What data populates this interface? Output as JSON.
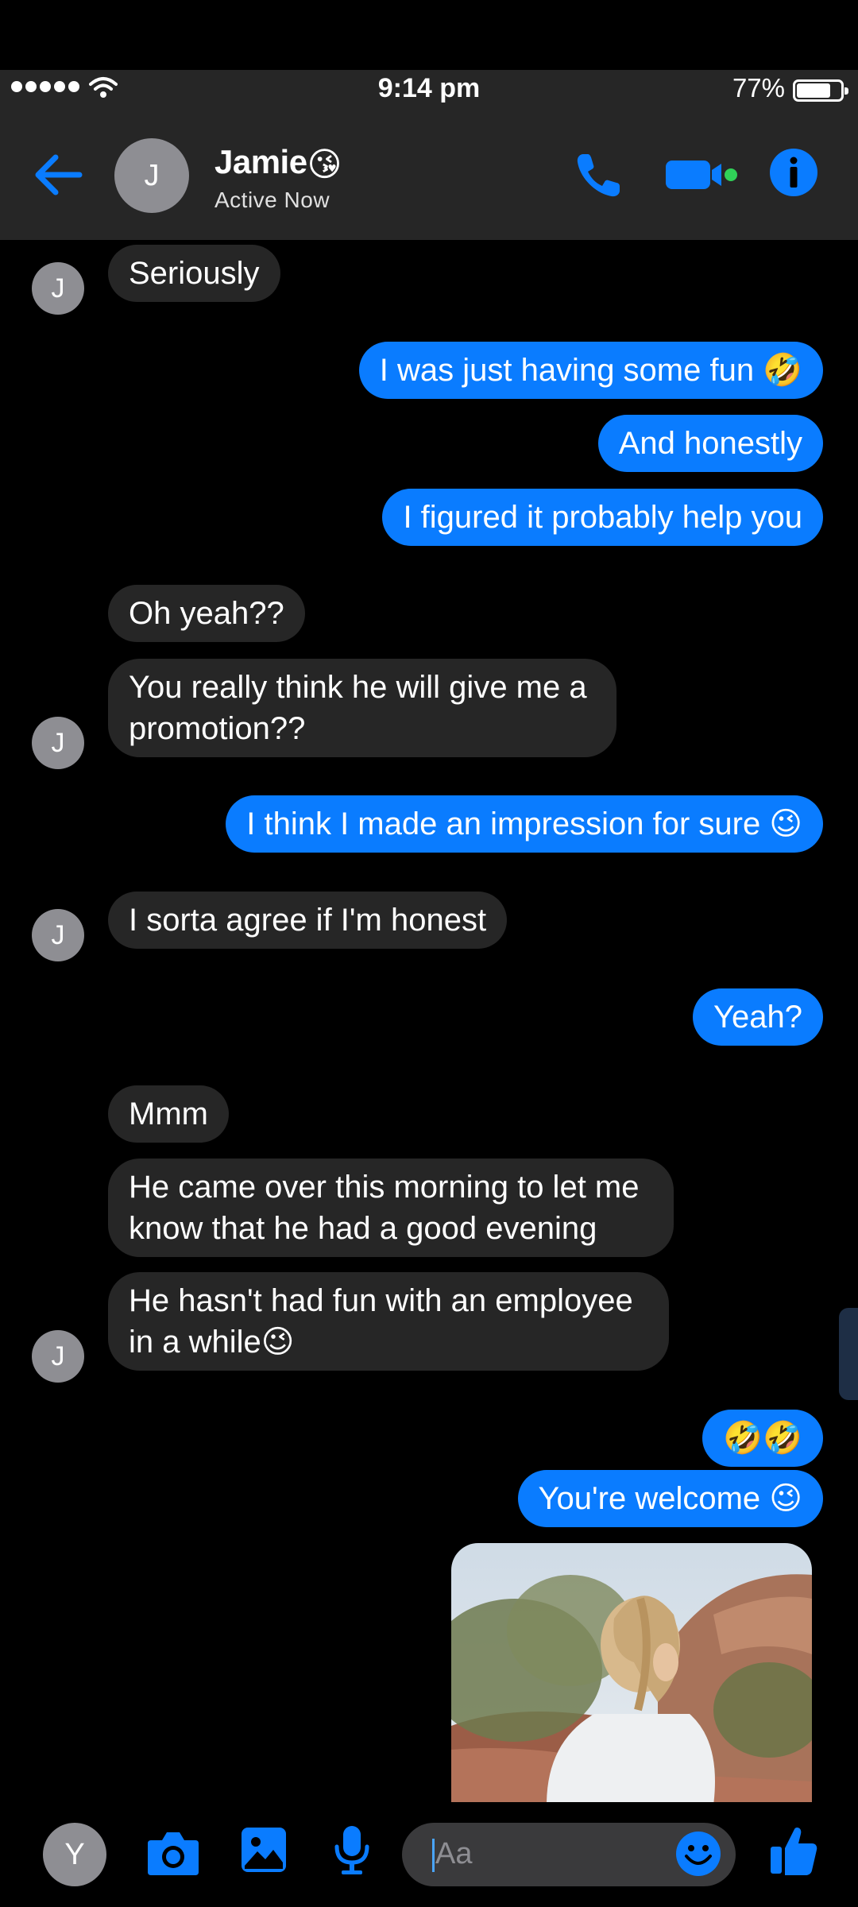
{
  "status_bar": {
    "time": "9:14 pm",
    "battery": "77%"
  },
  "header": {
    "avatar_initial": "J",
    "contact_name": "Jamie",
    "contact_emoji": "😘",
    "status": "Active Now"
  },
  "messages": [
    {
      "dir": "in",
      "text": "Seriously"
    },
    {
      "dir": "out",
      "text": "I was just having some fun 🤣"
    },
    {
      "dir": "out",
      "text": "And honestly"
    },
    {
      "dir": "out",
      "text": "I figured it probably help you"
    },
    {
      "dir": "in",
      "text": "Oh yeah??"
    },
    {
      "dir": "in",
      "text": "You really think he will give me a promotion??"
    },
    {
      "dir": "out",
      "text": "I think I made an impression for sure 😉"
    },
    {
      "dir": "in",
      "text": "I sorta agree if I'm honest"
    },
    {
      "dir": "out",
      "text": "Yeah?"
    },
    {
      "dir": "in",
      "text": "Mmm"
    },
    {
      "dir": "in",
      "text": "He came over this morning to let me know that he had a good evening"
    },
    {
      "dir": "in",
      "text": "He hasn't had fun with an employee in a while😉"
    },
    {
      "dir": "out",
      "text": "🤣🤣"
    },
    {
      "dir": "out",
      "text": "You're welcome 😉"
    }
  ],
  "sender_avatar_initial": "J",
  "composer": {
    "avatar_initial": "Y",
    "placeholder": "Aa"
  },
  "colors": {
    "accent": "#0a7cff",
    "incoming_bubble": "#262626",
    "header_bg": "#262626",
    "video_dot": "#30d158"
  },
  "icons": [
    "back-arrow-icon",
    "phone-icon",
    "video-camera-icon",
    "info-icon",
    "camera-icon",
    "image-icon",
    "microphone-icon",
    "emoji-icon",
    "thumbs-up-icon",
    "wifi-icon"
  ]
}
